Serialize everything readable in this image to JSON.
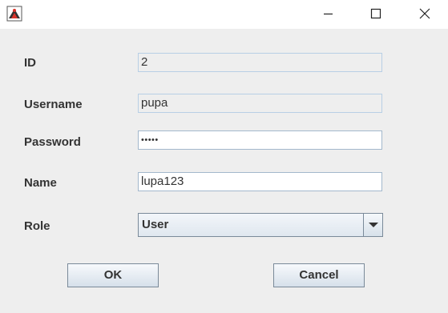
{
  "titlebar": {
    "title": "",
    "icons": {
      "app": "java-duke-icon",
      "minimize": "minimize-icon",
      "maximize": "maximize-icon",
      "close": "close-icon"
    }
  },
  "form": {
    "id_label": "ID",
    "id_value": "2",
    "username_label": "Username",
    "username_value": "pupa",
    "password_label": "Password",
    "password_value": "•••••",
    "name_label": "Name",
    "name_value": "lupa123",
    "role_label": "Role",
    "role_value": "User"
  },
  "buttons": {
    "ok_label": "OK",
    "cancel_label": "Cancel"
  },
  "colors": {
    "background": "#eeeeee",
    "titlebar": "#ffffff",
    "field_border": "#a3b8cc",
    "readonly_border": "#b8cfe5",
    "text": "#333333"
  }
}
